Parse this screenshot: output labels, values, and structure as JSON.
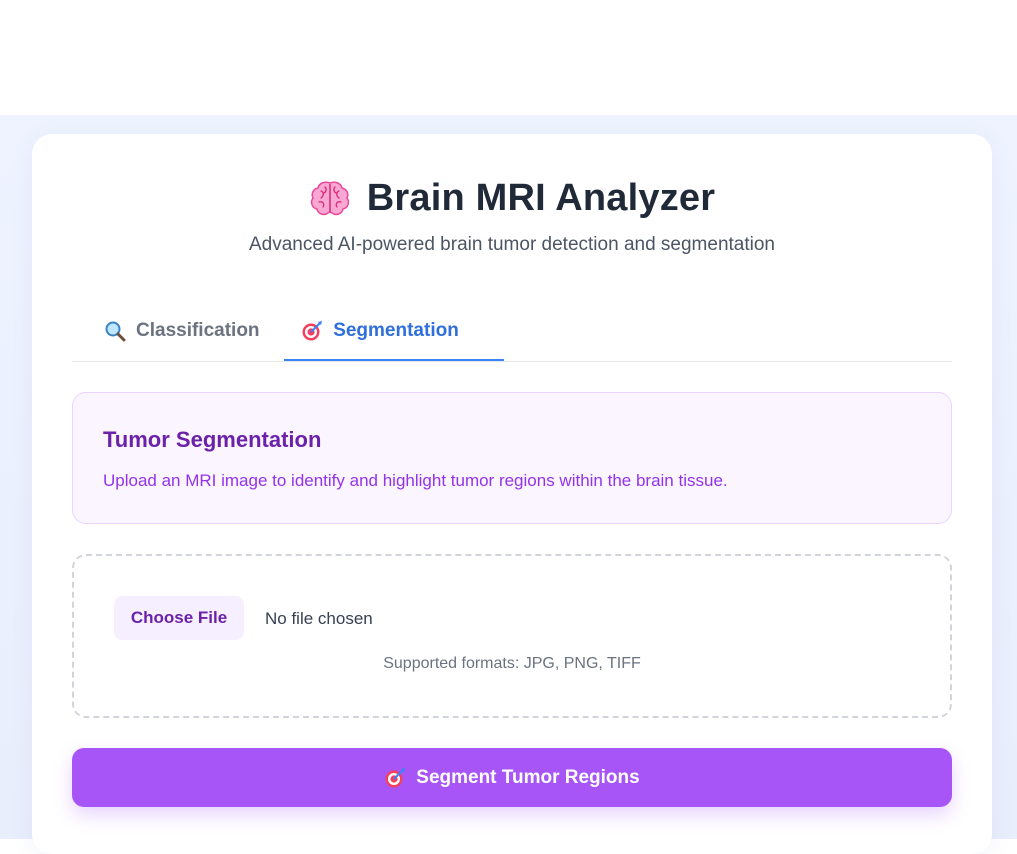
{
  "header": {
    "title": "Brain MRI Analyzer",
    "subtitle": "Advanced AI-powered brain tumor detection and segmentation",
    "icon": "brain-icon"
  },
  "tabs": [
    {
      "label": "Classification",
      "icon": "magnifier-icon",
      "active": false
    },
    {
      "label": "Segmentation",
      "icon": "target-icon",
      "active": true
    }
  ],
  "info": {
    "title": "Tumor Segmentation",
    "description": "Upload an MRI image to identify and highlight tumor regions within the brain tissue."
  },
  "upload": {
    "choose_label": "Choose File",
    "status": "No file chosen",
    "formats": "Supported formats: JPG, PNG, TIFF"
  },
  "submit": {
    "label": "Segment Tumor Regions",
    "icon": "target-icon"
  },
  "colors": {
    "accent": "#a855f7",
    "tab_active": "#2f6fdb",
    "info_title": "#6b21a8",
    "info_text": "#9333ea"
  }
}
